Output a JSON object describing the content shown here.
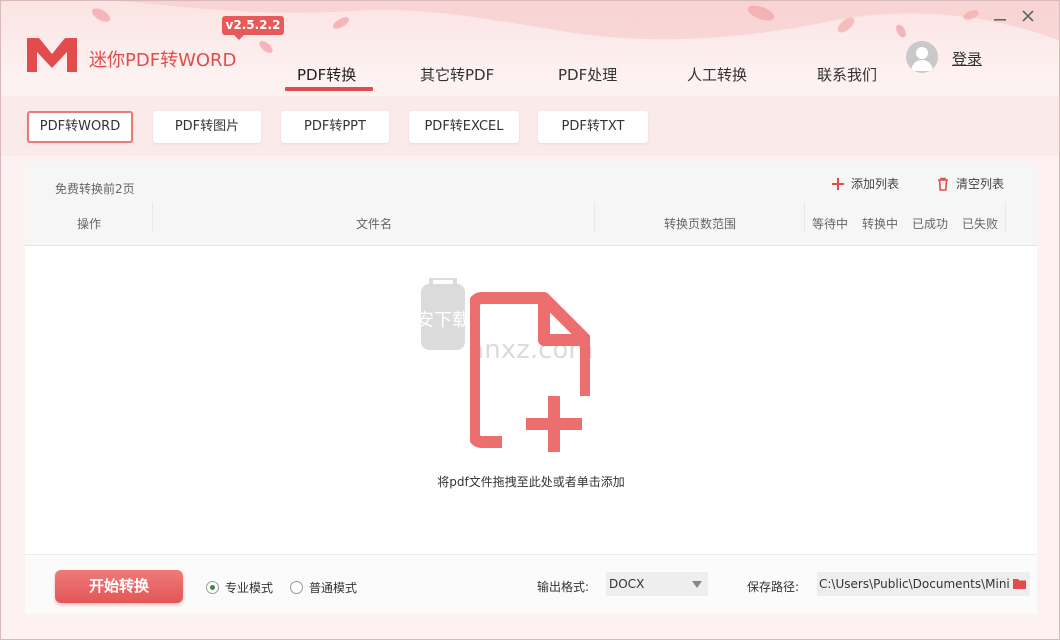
{
  "app": {
    "title": "迷你PDF转WORD",
    "version": "v2.5.2.2",
    "brand_color": "#e24c4c"
  },
  "nav": {
    "tabs": [
      {
        "label": "PDF转换",
        "active": true
      },
      {
        "label": "其它转PDF",
        "active": false
      },
      {
        "label": "PDF处理",
        "active": false
      },
      {
        "label": "人工转换",
        "active": false
      },
      {
        "label": "联系我们",
        "active": false
      }
    ]
  },
  "user": {
    "login_label": "登录"
  },
  "window_controls": {
    "minimize_icon": "minimize-icon",
    "close_icon": "close-icon"
  },
  "subtabs": [
    {
      "label": "PDF转WORD",
      "active": true
    },
    {
      "label": "PDF转图片",
      "active": false
    },
    {
      "label": "PDF转PPT",
      "active": false
    },
    {
      "label": "PDF转EXCEL",
      "active": false
    },
    {
      "label": "PDF转TXT",
      "active": false
    }
  ],
  "toolbar": {
    "free_note": "免费转换前2页",
    "add_list": "添加列表",
    "clear_list": "清空列表"
  },
  "table": {
    "columns": [
      "操作",
      "文件名",
      "转换页数范围",
      "等待中",
      "转换中",
      "已成功",
      "已失败"
    ]
  },
  "drop": {
    "hint": "将pdf文件拖拽至此处或者单击添加",
    "icon": "add-file-icon",
    "watermark_text": "安下载",
    "watermark_url": "anxz.com"
  },
  "bottom": {
    "start_label": "开始转换",
    "modes": [
      {
        "label": "专业模式",
        "checked": true
      },
      {
        "label": "普通模式",
        "checked": false
      }
    ],
    "output_format_label": "输出格式:",
    "output_format_value": "DOCX",
    "save_path_label": "保存路径:",
    "save_path_value": "C:\\Users\\Public\\Documents\\Mini"
  }
}
